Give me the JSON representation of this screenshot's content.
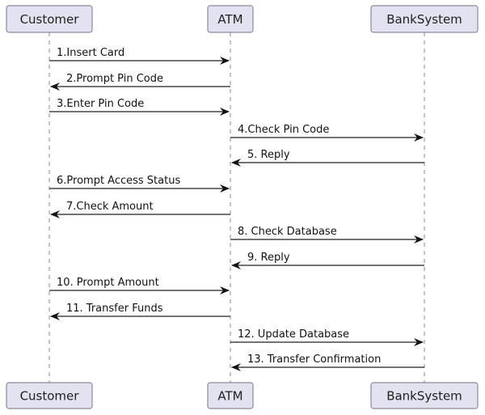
{
  "diagram": {
    "type": "sequence",
    "participants": [
      {
        "id": "customer",
        "label": "Customer"
      },
      {
        "id": "atm",
        "label": "ATM"
      },
      {
        "id": "bank",
        "label": "BankSystem"
      }
    ],
    "messages": [
      {
        "from": "customer",
        "to": "atm",
        "label": "1.Insert Card"
      },
      {
        "from": "atm",
        "to": "customer",
        "label": "2.Prompt Pin Code"
      },
      {
        "from": "customer",
        "to": "atm",
        "label": "3.Enter Pin Code"
      },
      {
        "from": "atm",
        "to": "bank",
        "label": "4.Check Pin Code"
      },
      {
        "from": "bank",
        "to": "atm",
        "label": "5. Reply"
      },
      {
        "from": "customer",
        "to": "atm",
        "label": "6.Prompt Access Status"
      },
      {
        "from": "atm",
        "to": "customer",
        "label": "7.Check Amount"
      },
      {
        "from": "atm",
        "to": "bank",
        "label": "8. Check  Database"
      },
      {
        "from": "bank",
        "to": "atm",
        "label": "9. Reply"
      },
      {
        "from": "customer",
        "to": "atm",
        "label": "10. Prompt Amount"
      },
      {
        "from": "atm",
        "to": "customer",
        "label": "11. Transfer Funds"
      },
      {
        "from": "atm",
        "to": "bank",
        "label": "12. Update Database"
      },
      {
        "from": "bank",
        "to": "atm",
        "label": "13. Transfer Confirmation"
      }
    ]
  }
}
